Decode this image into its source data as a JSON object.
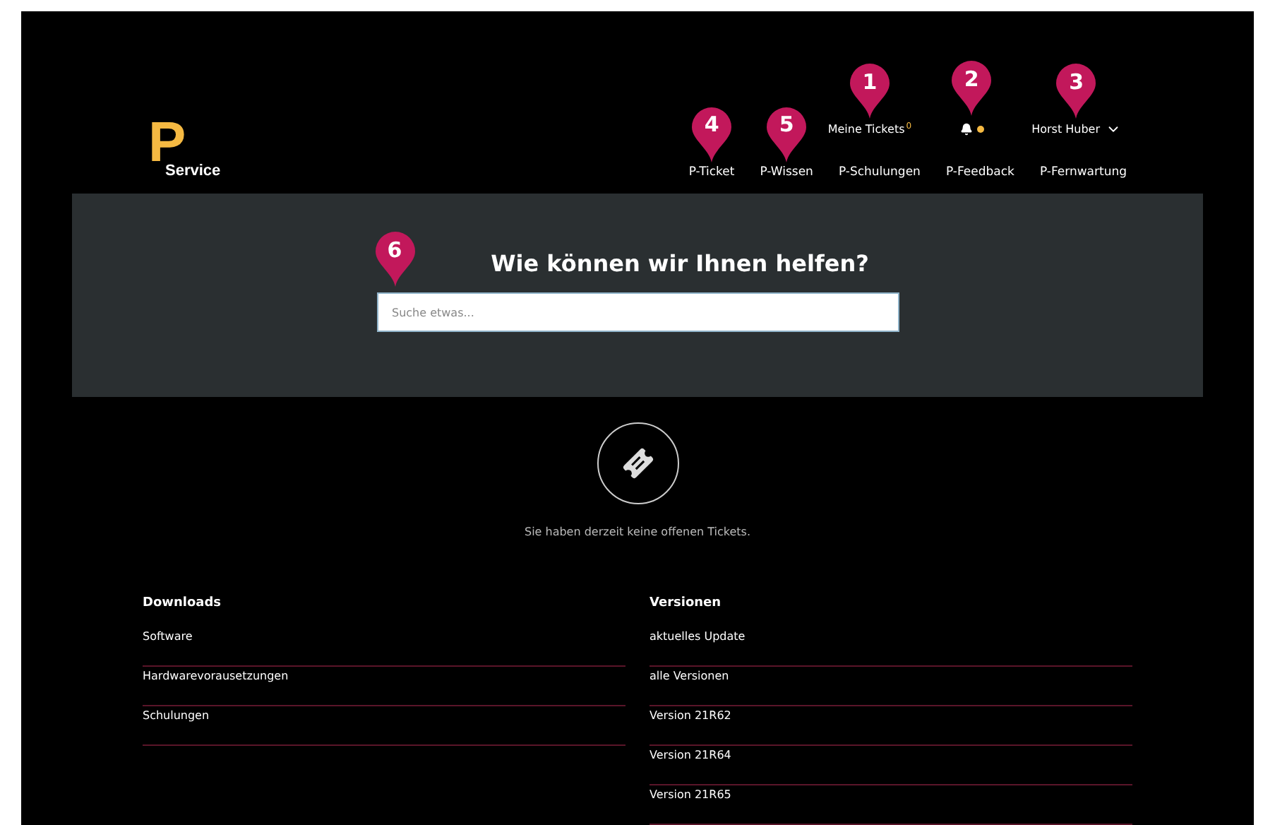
{
  "logo": {
    "letter": "P",
    "text": "Service"
  },
  "top_nav": [
    {
      "kind": "link",
      "label": "Meine Tickets",
      "count": "0",
      "marker": "1"
    },
    {
      "kind": "bell",
      "unread": true,
      "marker": "2"
    },
    {
      "kind": "user",
      "label": "Horst Huber",
      "marker": "3"
    }
  ],
  "main_nav": [
    {
      "label": "P-Ticket",
      "marker": "4"
    },
    {
      "label": "P-Wissen",
      "marker": "5"
    },
    {
      "label": "P-Schulungen"
    },
    {
      "label": "P-Feedback"
    },
    {
      "label": "P-Fernwartung"
    }
  ],
  "hero": {
    "title": "Wie können wir Ihnen helfen?",
    "search": {
      "placeholder": "Suche etwas...",
      "marker": "6"
    }
  },
  "tickets": {
    "empty_text": "Sie haben derzeit keine offenen Tickets."
  },
  "lists": [
    {
      "title": "Downloads",
      "items": [
        "Software",
        "Hardwarevorausetzungen",
        "Schulungen"
      ]
    },
    {
      "title": "Versionen",
      "items": [
        "aktuelles Update",
        "alle Versionen",
        "Version 21R62",
        "Version 21R64",
        "Version 21R65"
      ]
    }
  ]
}
